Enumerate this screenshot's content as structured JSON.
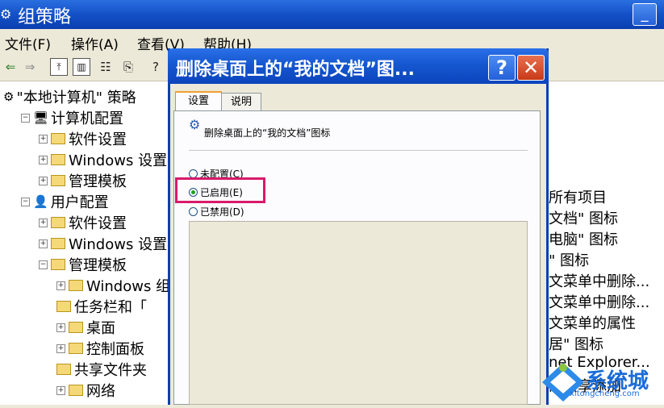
{
  "window": {
    "title": "组策略",
    "app_icon": "gpedit-icon"
  },
  "title_buttons": {
    "minimize": "_",
    "maximize": "□"
  },
  "menu": [
    {
      "label": "文件(F)"
    },
    {
      "label": "操作(A)"
    },
    {
      "label": "查看(V)"
    },
    {
      "label": "帮助(H)"
    }
  ],
  "toolbar": {
    "icons": [
      "back-icon",
      "forward-icon",
      "up-folder-icon",
      "show-tree-icon",
      "properties-icon",
      "export-icon",
      "help-icon"
    ]
  },
  "tree": [
    {
      "label": "\"本地计算机\" 策略",
      "icon": "policy-icon",
      "indent": 0,
      "expander": ""
    },
    {
      "label": "计算机配置",
      "icon": "computer-icon",
      "indent": 1,
      "expander": "−"
    },
    {
      "label": "软件设置",
      "icon": "folder-icon",
      "indent": 2,
      "expander": "+"
    },
    {
      "label": "Windows 设置",
      "icon": "folder-icon",
      "indent": 2,
      "expander": "+"
    },
    {
      "label": "管理模板",
      "icon": "folder-icon",
      "indent": 2,
      "expander": "+"
    },
    {
      "label": "用户配置",
      "icon": "user-icon",
      "indent": 1,
      "expander": "−"
    },
    {
      "label": "软件设置",
      "icon": "folder-icon",
      "indent": 2,
      "expander": "+"
    },
    {
      "label": "Windows 设置",
      "icon": "folder-icon",
      "indent": 2,
      "expander": "+"
    },
    {
      "label": "管理模板",
      "icon": "folder-icon",
      "indent": 2,
      "expander": "−"
    },
    {
      "label": "Windows 组",
      "icon": "folder-icon",
      "indent": 3,
      "expander": "+"
    },
    {
      "label": "任务栏和「",
      "icon": "folder-icon",
      "indent": 3,
      "expander": ""
    },
    {
      "label": "桌面",
      "icon": "folder-icon",
      "indent": 3,
      "expander": "+"
    },
    {
      "label": "控制面板",
      "icon": "folder-icon",
      "indent": 3,
      "expander": "+"
    },
    {
      "label": "共享文件夹",
      "icon": "folder-icon",
      "indent": 3,
      "expander": ""
    },
    {
      "label": "网络",
      "icon": "folder-icon",
      "indent": 3,
      "expander": "+"
    }
  ],
  "right_list": [
    "所有项目",
    "文档\" 图标",
    "电脑\" 图标",
    "\" 图标",
    "文菜单中删除...",
    "文菜单中删除...",
    "文菜单的属性",
    "居\" 图标",
    "net Explorer...",
    "的共享添加"
  ],
  "dialog": {
    "title": "删除桌面上的“我的文档”图...",
    "help_label": "?",
    "close_label": "✕",
    "tabs": [
      {
        "label": "设置"
      },
      {
        "label": "说明"
      }
    ],
    "policy_name": "删除桌面上的“我的文档”图标",
    "options": [
      {
        "label": "未配置(C)",
        "selected": false
      },
      {
        "label": "已启用(E)",
        "selected": true
      },
      {
        "label": "已禁用(D)",
        "selected": false
      }
    ]
  },
  "watermark": {
    "text": "系统城",
    "url": "xitongcheng.com"
  }
}
